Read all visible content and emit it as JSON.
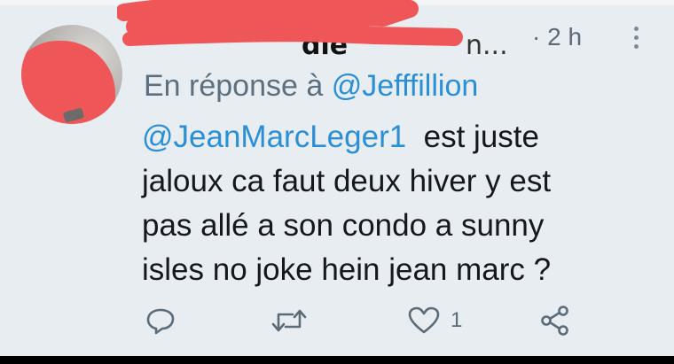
{
  "tweet": {
    "author_display": "die",
    "author_ellipsis": "n...",
    "time_separator": "·",
    "timestamp": "2 h",
    "reply_prefix": "En réponse à",
    "reply_to": "@Jefffillion",
    "body": {
      "mention": "@JeanMarcLeger1",
      "line1_rest": "est juste",
      "line2": "jaloux ca faut deux hiver y est",
      "line3": "pas allé a son condo a sunny",
      "line4": "isles no joke hein jean marc ?"
    },
    "actions": {
      "reply_icon": "reply-icon",
      "retweet_icon": "retweet-icon",
      "like_icon": "heart-icon",
      "like_count": "1",
      "share_icon": "share-icon"
    }
  },
  "colors": {
    "background": "#e8edf1",
    "mention": "#2b8fd6",
    "secondary_text": "#5b6f7f",
    "redaction": "#ef5658"
  }
}
